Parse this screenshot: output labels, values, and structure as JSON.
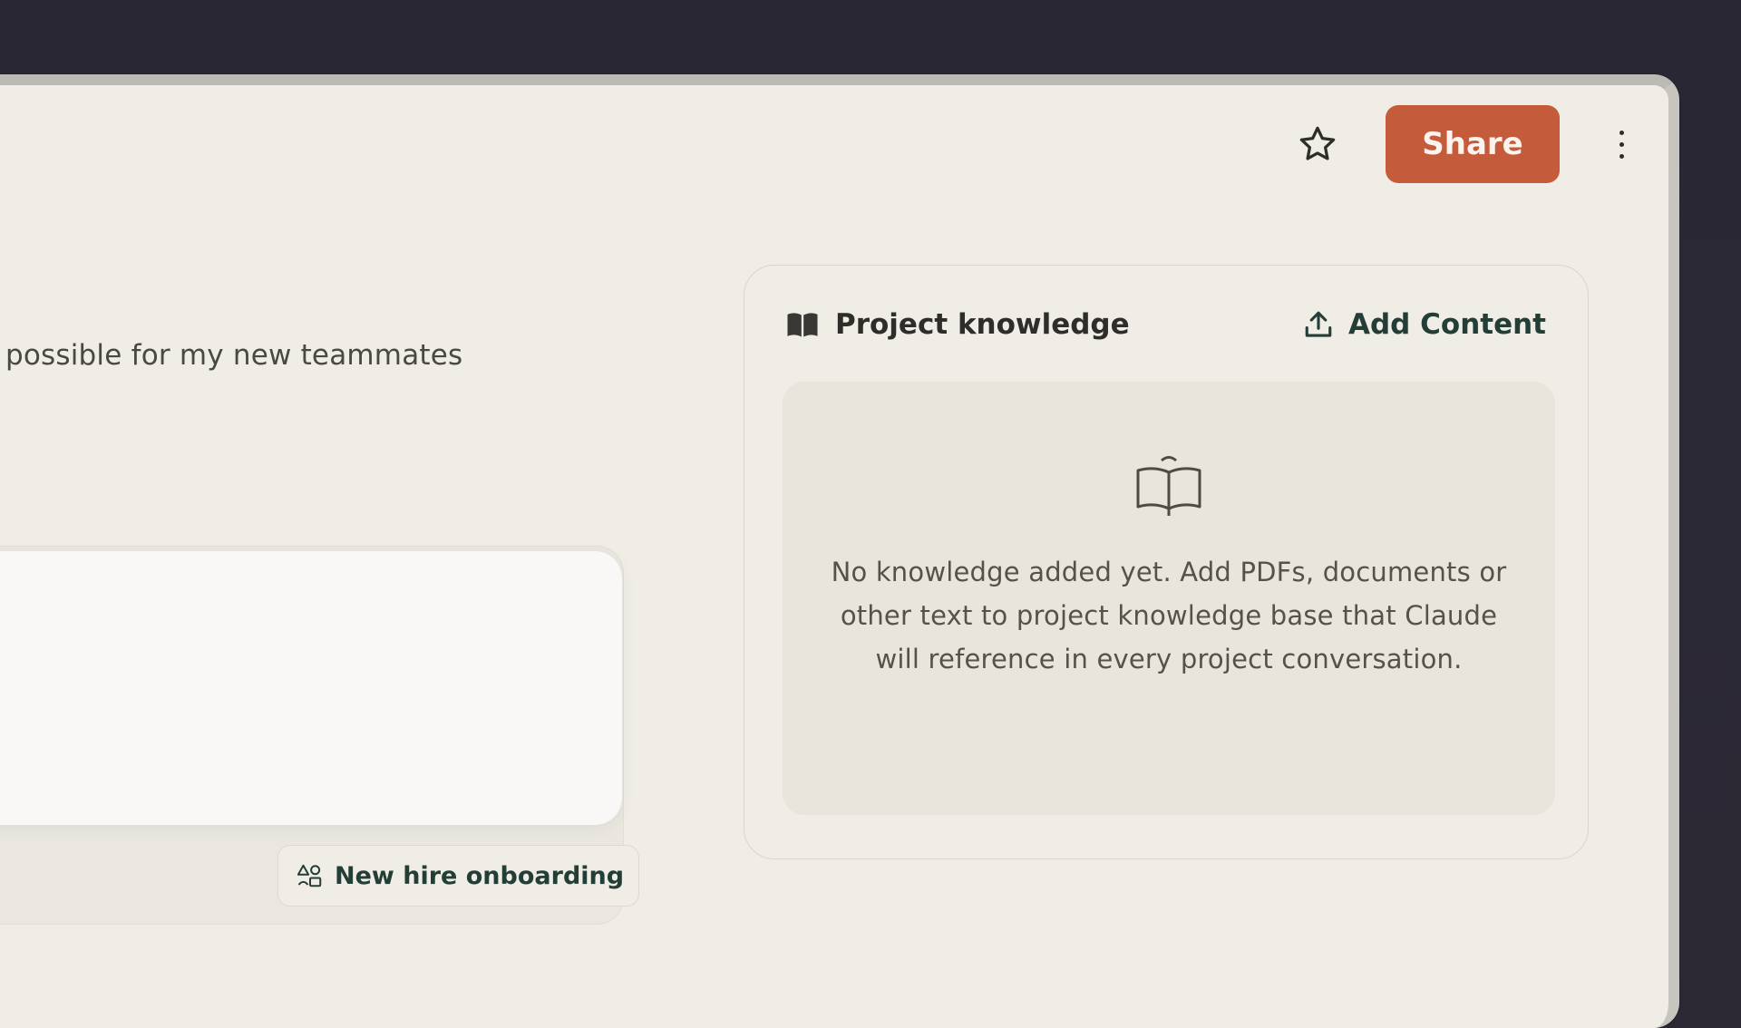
{
  "header": {
    "share_label": "Share",
    "icons": {
      "favorite": "star-icon",
      "more": "more-vertical-icon"
    }
  },
  "project": {
    "description_partial": "possible for my new teammates",
    "project_chip_label": "New hire onboarding",
    "project_chip_icon": "shapes-icon"
  },
  "knowledge": {
    "title": "Project knowledge",
    "title_icon": "book-icon",
    "add_label": "Add Content",
    "add_icon": "upload-icon",
    "empty_icon": "open-book-icon",
    "empty_text": "No knowledge added yet. Add PDFs, documents or other text to project knowledge base that Claude will reference in every project conversation."
  },
  "colors": {
    "accent": "#c45c3c",
    "accent_text": "#233e36",
    "background": "#efede6",
    "backdrop": "#2b2834"
  }
}
